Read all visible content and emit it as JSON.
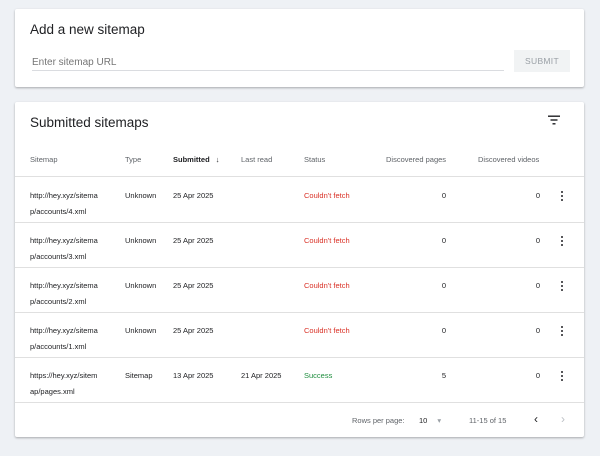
{
  "add": {
    "title": "Add a new sitemap",
    "placeholder": "Enter sitemap URL",
    "submit": "SUBMIT"
  },
  "submitted": {
    "title": "Submitted sitemaps",
    "columns": {
      "sitemap": "Sitemap",
      "type": "Type",
      "submitted": "Submitted",
      "last_read": "Last read",
      "status": "Status",
      "pages": "Discovered pages",
      "videos": "Discovered videos"
    },
    "rows": [
      {
        "url1": "http://hey.xyz/sitema",
        "url2": "p/accounts/4.xml",
        "type": "Unknown",
        "submitted": "25 Apr 2025",
        "last_read": "",
        "status": "Couldn't fetch",
        "pages": "0",
        "videos": "0"
      },
      {
        "url1": "http://hey.xyz/sitema",
        "url2": "p/accounts/3.xml",
        "type": "Unknown",
        "submitted": "25 Apr 2025",
        "last_read": "",
        "status": "Couldn't fetch",
        "pages": "0",
        "videos": "0"
      },
      {
        "url1": "http://hey.xyz/sitema",
        "url2": "p/accounts/2.xml",
        "type": "Unknown",
        "submitted": "25 Apr 2025",
        "last_read": "",
        "status": "Couldn't fetch",
        "pages": "0",
        "videos": "0"
      },
      {
        "url1": "http://hey.xyz/sitema",
        "url2": "p/accounts/1.xml",
        "type": "Unknown",
        "submitted": "25 Apr 2025",
        "last_read": "",
        "status": "Couldn't fetch",
        "pages": "0",
        "videos": "0"
      },
      {
        "url1": "https://hey.xyz/sitem",
        "url2": "ap/pages.xml",
        "type": "Sitemap",
        "submitted": "13 Apr 2025",
        "last_read": "21 Apr 2025",
        "status": "Success",
        "pages": "5",
        "videos": "0"
      }
    ],
    "footer": {
      "rows_label": "Rows per page:",
      "rows_value": "10",
      "range": "11-15 of 15"
    }
  },
  "colors": {
    "error": "#d93025",
    "success": "#1e8e3e"
  }
}
